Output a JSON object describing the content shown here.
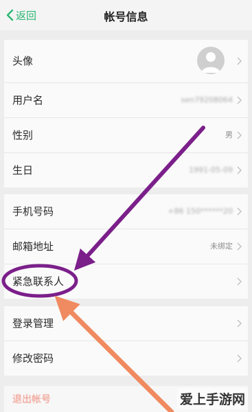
{
  "header": {
    "back_label": "返回",
    "title": "帐号信息"
  },
  "profile": {
    "avatar_label": "头像",
    "username_label": "用户名",
    "username_value": "sen79208064",
    "gender_label": "性别",
    "gender_value": "男",
    "birthday_label": "生日",
    "birthday_value": "1991-05-09"
  },
  "contact": {
    "phone_label": "手机号码",
    "phone_value": "+86 150******20",
    "email_label": "邮箱地址",
    "email_value": "未绑定",
    "emergency_label": "紧急联系人"
  },
  "security": {
    "login_label": "登录管理",
    "password_label": "修改密码"
  },
  "logout_label": "退出帐号",
  "annotations": {
    "circle_color": "#7b1f8a",
    "arrow_purple": "#7b1f8a",
    "arrow_orange": "#f08a60"
  },
  "watermark": "爱上手游网"
}
